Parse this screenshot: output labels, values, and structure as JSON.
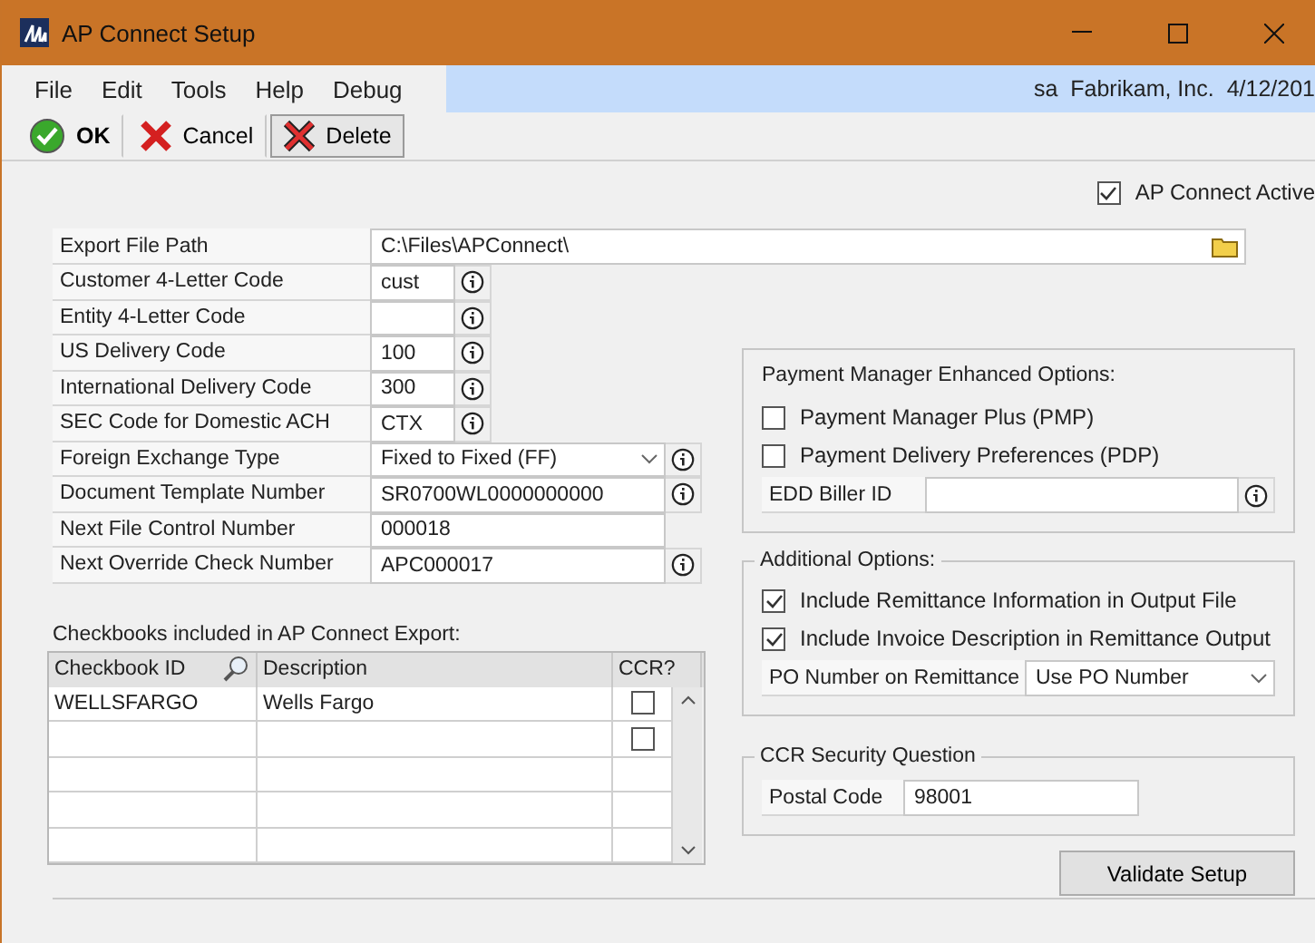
{
  "window": {
    "title": "AP Connect Setup"
  },
  "menu": {
    "items": [
      "File",
      "Edit",
      "Tools",
      "Help",
      "Debug"
    ],
    "user": "sa",
    "company": "Fabrikam, Inc.",
    "date": "4/12/201"
  },
  "toolbar": [
    {
      "label": "OK",
      "kind": "ok",
      "focused": false
    },
    {
      "label": "Cancel",
      "kind": "cancel",
      "focused": false
    },
    {
      "label": "Delete",
      "kind": "delete",
      "focused": true
    }
  ],
  "ap_connect_active": {
    "label": "AP Connect Active",
    "checked": true
  },
  "export_path": {
    "label": "Export File Path",
    "value": "C:\\Files\\APConnect\\"
  },
  "fields": [
    {
      "label": "Customer 4-Letter Code",
      "value": "cust",
      "kind": "short",
      "info": true
    },
    {
      "label": "Entity 4-Letter Code",
      "kind": "short",
      "info": true
    },
    {
      "label": "US Delivery Code",
      "value": "100",
      "kind": "short",
      "info": true
    },
    {
      "label": "International Delivery Code",
      "value": "300",
      "kind": "short",
      "info": true
    },
    {
      "label": "SEC Code for Domestic ACH",
      "value": "CTX",
      "kind": "short",
      "info": true
    },
    {
      "label": "Foreign Exchange Type",
      "value": "Fixed to Fixed (FF)",
      "kind": "dropdown",
      "info": true
    },
    {
      "label": "Document Template Number",
      "value": "SR0700WL0000000000",
      "kind": "long",
      "info": true
    },
    {
      "label": "Next File Control Number",
      "value": "000018",
      "kind": "long",
      "info": false
    },
    {
      "label": "Next Override Check Number",
      "value": "APC000017",
      "kind": "long",
      "info": true
    }
  ],
  "checkbooks": {
    "title": "Checkbooks included in AP Connect Export:",
    "columns": [
      "Checkbook ID",
      "Description",
      "CCR?"
    ],
    "rows": [
      {
        "checkbook_id": "WELLSFARGO",
        "description": "Wells Fargo",
        "ccr": false
      },
      {
        "ccr": false
      }
    ]
  },
  "payment_manager": {
    "title": "Payment Manager Enhanced Options:",
    "options": [
      {
        "label": "Payment Manager Plus (PMP)",
        "checked": false
      },
      {
        "label": "Payment Delivery Preferences (PDP)",
        "checked": false
      }
    ],
    "edd_biller": {
      "label": "EDD Biller ID"
    }
  },
  "additional": {
    "title": "Additional Options:",
    "options": [
      {
        "label": "Include Remittance Information in Output File",
        "checked": true
      },
      {
        "label": "Include Invoice Description in Remittance Output",
        "checked": true
      }
    ],
    "po_number": {
      "label": "PO Number on Remittance",
      "value": "Use PO Number"
    }
  },
  "ccr_security": {
    "title": "CCR Security Question",
    "postal_code": {
      "label": "Postal Code",
      "value": "98001"
    }
  },
  "validate_button": "Validate Setup"
}
